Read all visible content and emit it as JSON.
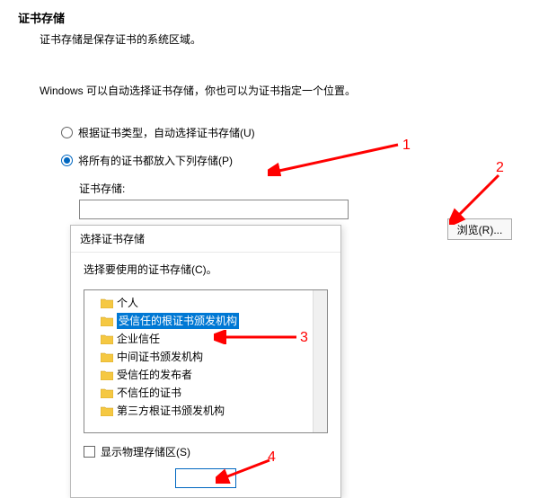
{
  "wizard": {
    "title": "证书存储",
    "subtitle": "证书存储是保存证书的系统区域。",
    "description": "Windows 可以自动选择证书存储，你也可以为证书指定一个位置。",
    "radio_auto": "根据证书类型，自动选择证书存储(U)",
    "radio_place": "将所有的证书都放入下列存储(P)",
    "store_label": "证书存储:",
    "browse_btn": "浏览(R)..."
  },
  "popup": {
    "title": "选择证书存储",
    "desc": "选择要使用的证书存储(C)。",
    "tree_items": [
      "个人",
      "受信任的根证书颁发机构",
      "企业信任",
      "中间证书颁发机构",
      "受信任的发布者",
      "不信任的证书",
      "第三方根证书颁发机构"
    ],
    "selected_index": 1,
    "checkbox_label": "显示物理存储区(S)"
  },
  "annotations": {
    "n1": "1",
    "n2": "2",
    "n3": "3",
    "n4": "4"
  }
}
